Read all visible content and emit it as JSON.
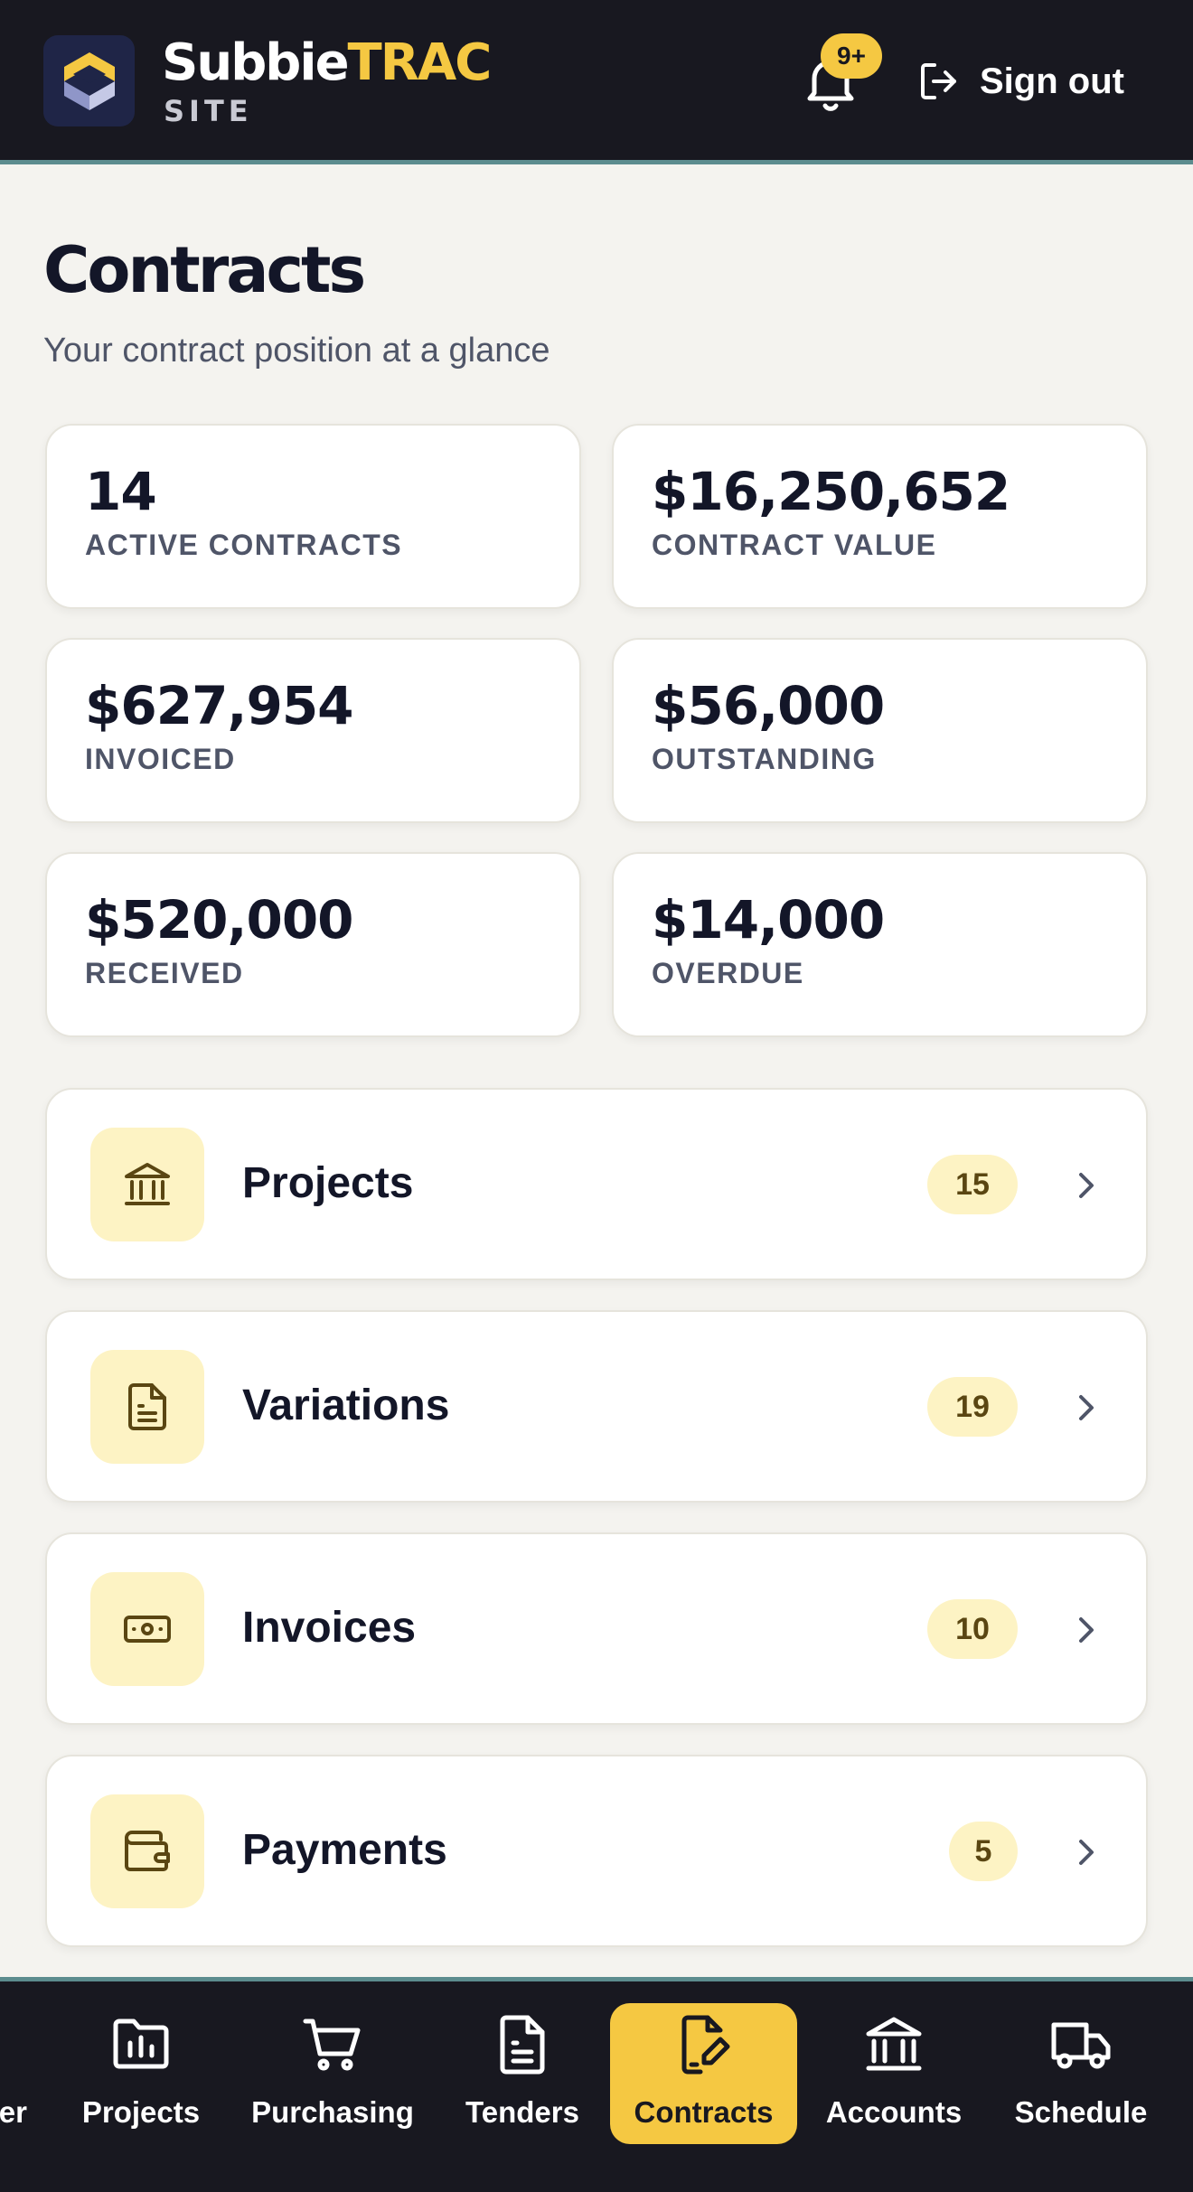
{
  "app": {
    "brand_part1": "Subbie",
    "brand_part2": "TRAC",
    "brand_sub": "SITE",
    "notifications_badge": "9+",
    "sign_out_label": "Sign out"
  },
  "page": {
    "title": "Contracts",
    "subtitle": "Your contract position at a glance"
  },
  "stats": [
    {
      "value": "14",
      "label": "ACTIVE CONTRACTS"
    },
    {
      "value": "$16,250,652",
      "label": "CONTRACT VALUE"
    },
    {
      "value": "$627,954",
      "label": "INVOICED"
    },
    {
      "value": "$56,000",
      "label": "OUTSTANDING"
    },
    {
      "value": "$520,000",
      "label": "RECEIVED"
    },
    {
      "value": "$14,000",
      "label": "OVERDUE"
    }
  ],
  "sections": [
    {
      "label": "Projects",
      "count": "15",
      "icon": "bank-icon"
    },
    {
      "label": "Variations",
      "count": "19",
      "icon": "document-icon"
    },
    {
      "label": "Invoices",
      "count": "10",
      "icon": "banknote-icon"
    },
    {
      "label": "Payments",
      "count": "5",
      "icon": "wallet-icon"
    }
  ],
  "nav": {
    "partial_label": "er",
    "items": [
      {
        "label": "Projects",
        "icon": "folder-chart-icon",
        "active": false
      },
      {
        "label": "Purchasing",
        "icon": "cart-icon",
        "active": false
      },
      {
        "label": "Tenders",
        "icon": "file-text-icon",
        "active": false
      },
      {
        "label": "Contracts",
        "icon": "file-signature-icon",
        "active": true
      },
      {
        "label": "Accounts",
        "icon": "bank-icon",
        "active": false
      },
      {
        "label": "Schedule",
        "icon": "truck-icon",
        "active": false
      }
    ]
  },
  "colors": {
    "header_bg": "#181820",
    "accent_yellow": "#f5c842",
    "accent_teal": "#5c8c8e",
    "page_bg": "#f4f3ef",
    "icon_tile_bg": "#fdf3c4",
    "icon_brown": "#5a4612"
  }
}
